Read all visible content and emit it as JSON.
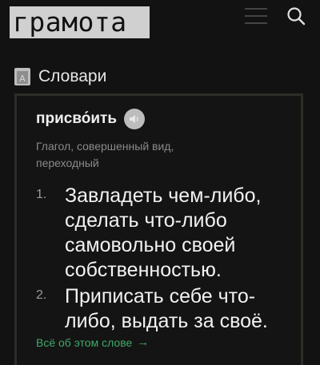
{
  "header": {
    "logo_text": "грамота",
    "menu_icon": "hamburger-menu-icon",
    "search_icon": "search-icon"
  },
  "section": {
    "icon": "book-icon",
    "title": "Словари"
  },
  "entry": {
    "word": "присво́ить",
    "audio_icon": "speaker-icon",
    "grammar": "Глагол, совершенный вид, переходный",
    "definitions": [
      {
        "num": "1.",
        "text": "Завладеть чем-либо, сделать что-либо самовольно своей собственностью."
      },
      {
        "num": "2.",
        "text": "Приписать себе что-либо, выдать за своё."
      }
    ],
    "more_link": "Всё об этом слове",
    "more_arrow": "→"
  },
  "colors": {
    "background": "#121212",
    "logo_bg": "#d0d0d0",
    "link": "#3fa96a",
    "muted_text": "#8a8a8a"
  }
}
